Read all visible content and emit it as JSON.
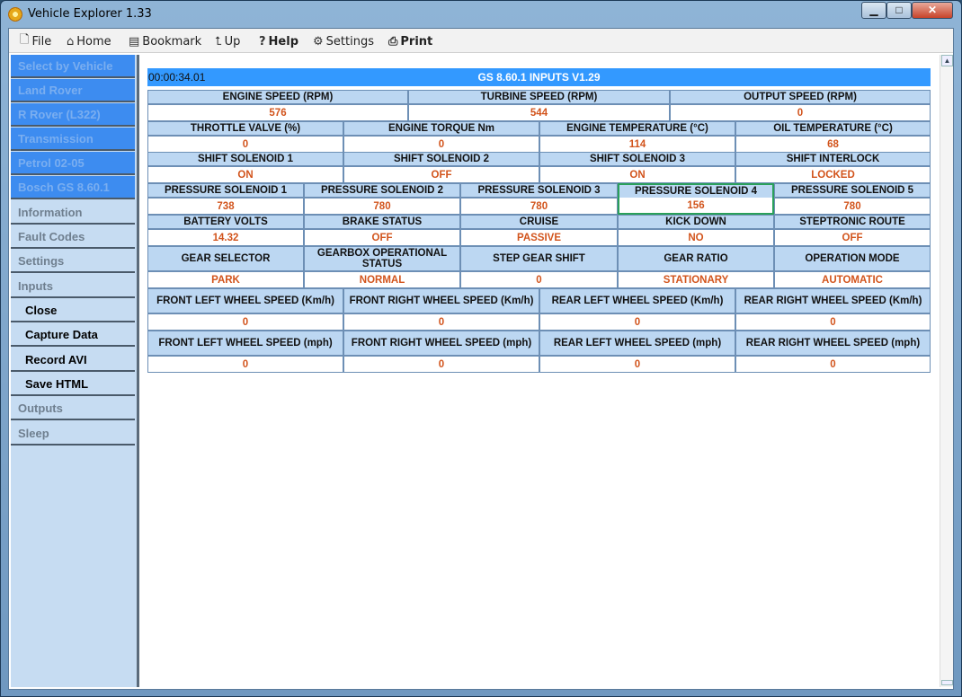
{
  "window": {
    "title": "Vehicle Explorer 1.33",
    "min": "▁",
    "max": "□",
    "close": "✕"
  },
  "menu": [
    {
      "label": "File",
      "icon": "file-icon",
      "glyph": "🗋"
    },
    {
      "label": "Home",
      "icon": "home-icon",
      "glyph": "⌂"
    },
    {
      "label": "Bookmark",
      "icon": "bookmark-icon",
      "glyph": "▤"
    },
    {
      "label": "Up",
      "icon": "up-folder-icon",
      "glyph": "⮤"
    },
    {
      "label": "Help",
      "icon": "help-icon",
      "glyph": "?"
    },
    {
      "label": "Settings",
      "icon": "settings-icon",
      "glyph": "⚙"
    },
    {
      "label": "Print",
      "icon": "printer-icon",
      "glyph": "⎙"
    }
  ],
  "sidebar": {
    "crumbs": [
      "Select by Vehicle",
      "Land Rover",
      "R Rover (L322)",
      "Transmission",
      "Petrol 02-05",
      "Bosch GS 8.60.1"
    ],
    "menu_top": [
      "Information",
      "Fault Codes",
      "Settings",
      "Inputs"
    ],
    "sub": [
      "Close",
      "Capture Data",
      "Record AVI",
      "Save HTML"
    ],
    "menu_bottom": [
      "Outputs",
      "Sleep"
    ]
  },
  "header": {
    "time": "00:00:34.01",
    "title": "GS 8.60.1 INPUTS V1.29"
  },
  "grid": {
    "speeds": {
      "labels": [
        "ENGINE SPEED (RPM)",
        "TURBINE SPEED (RPM)",
        "OUTPUT SPEED (RPM)"
      ],
      "values": [
        "576",
        "544",
        "0"
      ]
    },
    "temps": {
      "labels": [
        "THROTTLE VALVE (%)",
        "ENGINE TORQUE Nm",
        "ENGINE TEMPERATURE (°C)",
        "OIL TEMPERATURE (°C)"
      ],
      "values": [
        "0",
        "0",
        "114",
        "68"
      ]
    },
    "shift": {
      "labels": [
        "SHIFT SOLENOID 1",
        "SHIFT SOLENOID 2",
        "SHIFT SOLENOID 3",
        "SHIFT INTERLOCK"
      ],
      "values": [
        "ON",
        "OFF",
        "ON",
        "LOCKED"
      ]
    },
    "pressure": {
      "labels": [
        "PRESSURE SOLENOID 1",
        "PRESSURE SOLENOID 2",
        "PRESSURE SOLENOID 3",
        "PRESSURE SOLENOID 4",
        "PRESSURE SOLENOID 5"
      ],
      "values": [
        "738",
        "780",
        "780",
        "156",
        "780"
      ]
    },
    "status": {
      "labels": [
        "BATTERY VOLTS",
        "BRAKE STATUS",
        "CRUISE",
        "KICK DOWN",
        "STEPTRONIC ROUTE"
      ],
      "values": [
        "14.32",
        "OFF",
        "PASSIVE",
        "NO",
        "OFF"
      ]
    },
    "gear": {
      "labels": [
        "GEAR SELECTOR",
        "GEARBOX OPERATIONAL STATUS",
        "STEP GEAR SHIFT",
        "GEAR RATIO",
        "OPERATION MODE"
      ],
      "values": [
        "PARK",
        "NORMAL",
        "0",
        "STATIONARY",
        "AUTOMATIC"
      ]
    },
    "wheel_kmh": {
      "labels": [
        "FRONT LEFT WHEEL SPEED (Km/h)",
        "FRONT RIGHT WHEEL SPEED (Km/h)",
        "REAR LEFT WHEEL SPEED (Km/h)",
        "REAR RIGHT WHEEL SPEED (Km/h)"
      ],
      "values": [
        "0",
        "0",
        "0",
        "0"
      ]
    },
    "wheel_mph": {
      "labels": [
        "FRONT LEFT WHEEL SPEED (mph)",
        "FRONT RIGHT WHEEL SPEED (mph)",
        "REAR LEFT WHEEL SPEED (mph)",
        "REAR RIGHT WHEEL SPEED (mph)"
      ],
      "values": [
        "0",
        "0",
        "0",
        "0"
      ]
    }
  },
  "colors": {
    "header": "#3399ff",
    "label_bg": "#bcd7f2",
    "value_text": "#d2541c",
    "highlight": "#2aa05a"
  }
}
